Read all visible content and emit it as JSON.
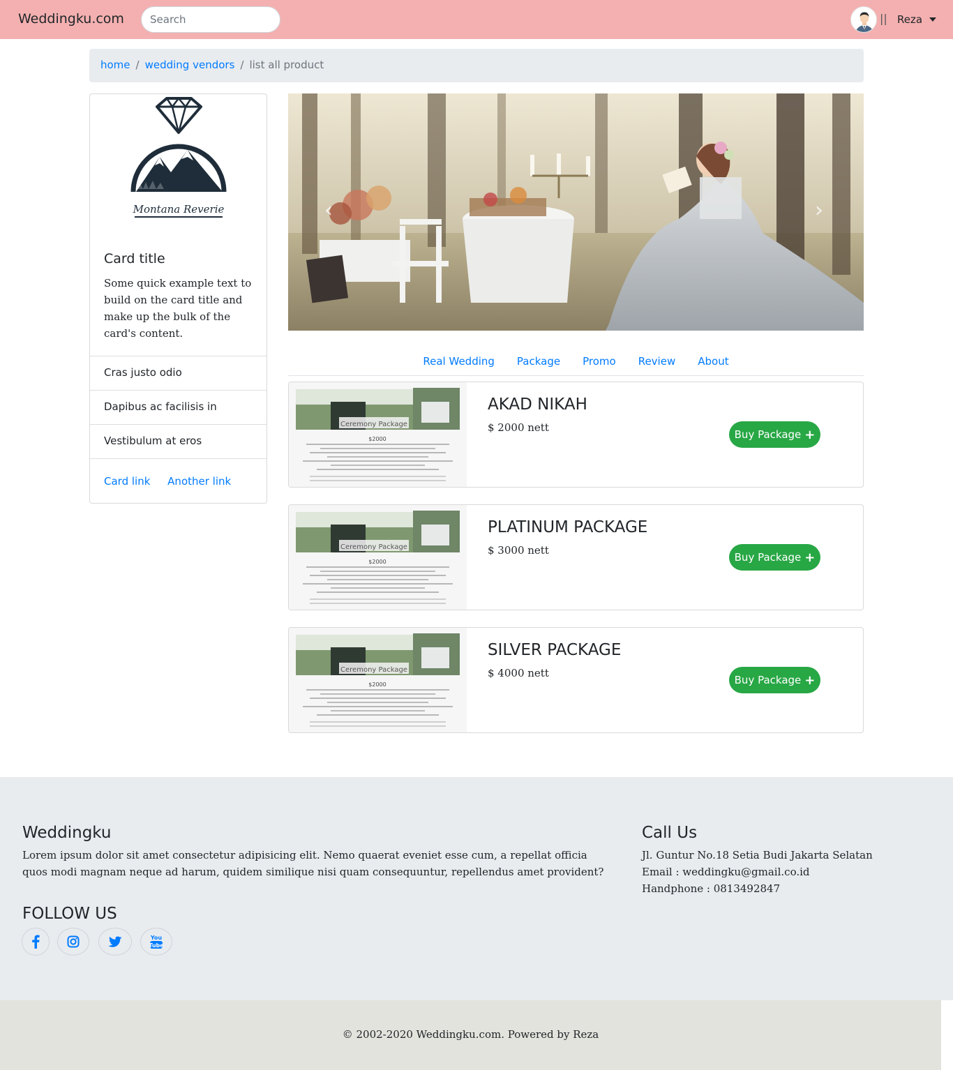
{
  "navbar": {
    "brand": "Weddingku.com",
    "search_placeholder": "Search",
    "separator": "||",
    "user_name": "Reza",
    "bg_color": "#f4b0b0"
  },
  "breadcrumb": {
    "items": [
      "home",
      "wedding vendors"
    ],
    "active": "list all product"
  },
  "side_card": {
    "logo_text": "Montana Reverie",
    "title": "Card title",
    "text": "Some quick example text to build on the card title and make up the bulk of the card's content.",
    "list": [
      "Cras justo odio",
      "Dapibus ac facilisis in",
      "Vestibulum at eros"
    ],
    "link1": "Card link",
    "link2": "Another link"
  },
  "carousel": {
    "prev_icon": "chevron-left-icon",
    "next_icon": "chevron-right-icon"
  },
  "tabs": [
    "Real Wedding",
    "Package",
    "Promo",
    "Review",
    "About"
  ],
  "packages": [
    {
      "name": "AKAD NIKAH",
      "price": "$ 2000 nett",
      "button": "Buy Package",
      "thumb_caption": "Ceremony Package",
      "thumb_price": "$2000"
    },
    {
      "name": "PLATINUM PACKAGE",
      "price": "$ 3000 nett",
      "button": "Buy Package",
      "thumb_caption": "Ceremony Package",
      "thumb_price": "$2000"
    },
    {
      "name": "SILVER PACKAGE",
      "price": "$ 4000 nett",
      "button": "Buy Package",
      "thumb_caption": "Ceremony Package",
      "thumb_price": "$2000"
    }
  ],
  "footer": {
    "about_title": "Weddingku",
    "about_text": "Lorem ipsum dolor sit amet consectetur adipisicing elit. Nemo quaerat eveniet esse cum, a repellat officia quos modi magnam neque ad harum, quidem similique nisi quam consequuntur, repellendus amet provident?",
    "follow_title": "FOLLOW US",
    "social": [
      "facebook-icon",
      "instagram-icon",
      "twitter-icon",
      "youtube-icon"
    ],
    "call_title": "Call Us",
    "address": "Jl. Guntur No.18 Setia Budi Jakarta Selatan",
    "email": "Email : weddingku@gmail.co.id",
    "phone": "Handphone : 0813492847",
    "copyright": "© 2002-2020 Weddingku.com. Powered by Reza"
  },
  "colors": {
    "accent": "#007bff",
    "success": "#28a745",
    "footer_bg": "#e9ecef"
  }
}
